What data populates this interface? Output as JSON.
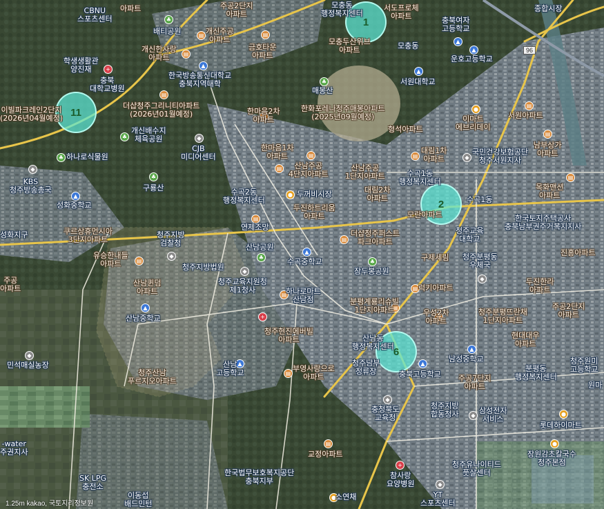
{
  "map": {
    "road_badge": "96",
    "copyright": "1.25m  kakao, 국토지리정보원"
  },
  "clusters": [
    {
      "id": "c1",
      "label": "1"
    },
    {
      "id": "c2",
      "label": "2"
    },
    {
      "id": "c6",
      "label": "6"
    },
    {
      "id": "c11",
      "label": "11"
    }
  ],
  "places": [
    {
      "text": "CBNU\n스포츠센터"
    },
    {
      "text": "아파트"
    },
    {
      "text": "배티공원"
    },
    {
      "text": "주공2단지\n아파트"
    },
    {
      "text": "개신주공\n아파트"
    },
    {
      "text": "금호타운\n아파트"
    },
    {
      "text": "모충동\n행정복지센터"
    },
    {
      "text": "서도프로체\n아파트"
    },
    {
      "text": "충북여자\n고등학교"
    },
    {
      "text": "종합시장"
    },
    {
      "text": "학생생활관\n양진재"
    },
    {
      "text": "개신한사랑\n아파트"
    },
    {
      "text": "한국방송통신대학교\n충북지역대학"
    },
    {
      "text": "모충두산위브\n아파트"
    },
    {
      "text": "모충동"
    },
    {
      "text": "운호고등학교"
    },
    {
      "text": "충북\n대학교병원"
    },
    {
      "text": "매봉산"
    },
    {
      "text": "서원대학교"
    },
    {
      "text": "더샵청주그리니티아파트\n(2026년01월예정)"
    },
    {
      "text": "한마음2차\n아파트"
    },
    {
      "text": "한화포레나청주매봉아파트\n(2025년09월예정)"
    },
    {
      "text": "이마트\n에브리데이"
    },
    {
      "text": "서원아파트"
    },
    {
      "text": "이빌파크레인2단지\n(2026년04월예정)"
    },
    {
      "text": "개신배수지\n체육공원"
    },
    {
      "text": "형석아파트"
    },
    {
      "text": "CJB\n미디어센터"
    },
    {
      "text": "한마음1차\n아파트"
    },
    {
      "text": "대림1차\n아파트"
    },
    {
      "text": "국민건강보험공단\n청주서원지사"
    },
    {
      "text": "남부상가\n아파트"
    },
    {
      "text": "하나로식물원"
    },
    {
      "text": "산남주공\n4단지아파트"
    },
    {
      "text": "산남주공\n1단지아파트"
    },
    {
      "text": "수곡1동\n행정복지센터"
    },
    {
      "text": "KBS\n청주방송총국"
    },
    {
      "text": "구룡산"
    },
    {
      "text": "수곡2동\n행정복지센터"
    },
    {
      "text": "두꺼비시장"
    },
    {
      "text": "대림2차\n아파트"
    },
    {
      "text": "목화맨션\n아파트"
    },
    {
      "text": "성화중학교"
    },
    {
      "text": "두진하트리움\n아파트"
    },
    {
      "text": "모란아파트"
    },
    {
      "text": "수곡1동"
    },
    {
      "text": "한국토지주택공사\n충북남부권주거복지지사"
    },
    {
      "text": "쿠르상휴먼시아\n3단지아파트"
    },
    {
      "text": "청주지방\n검찰청"
    },
    {
      "text": "연제조망"
    },
    {
      "text": "더샵청주퍼스트\n파크아파트"
    },
    {
      "text": "청주교육\n대학교"
    },
    {
      "text": "성화지구"
    },
    {
      "text": "산남공원"
    },
    {
      "text": "유승한내들\n아파트"
    },
    {
      "text": "청주지방법원"
    },
    {
      "text": "수곡중학교"
    },
    {
      "text": "구제세림"
    },
    {
      "text": "청주분평동\n우체국"
    },
    {
      "text": "진흥아파트"
    },
    {
      "text": "잠두봉공원"
    },
    {
      "text": "산남퀸덤\n아파트"
    },
    {
      "text": "청주교육지원청\n제1청사"
    },
    {
      "text": "두진한라\n아파트"
    },
    {
      "text": "주공\n아파트"
    },
    {
      "text": "하나로마트\n산남점"
    },
    {
      "text": "럭키아파트"
    },
    {
      "text": "분평계룡리슈빌\n1단지아파트"
    },
    {
      "text": "주공2단지\n아파트"
    },
    {
      "text": "청주분평뜨란채\n1단지아파트"
    },
    {
      "text": "산남중학교"
    },
    {
      "text": "우성2차\n아파트"
    },
    {
      "text": "청주현진에버빌\n아파트"
    },
    {
      "text": "현대대우\n아파트"
    },
    {
      "text": "산남동\n행정복지센터"
    },
    {
      "text": "남성중학교"
    },
    {
      "text": "청주원미\n고등학교"
    },
    {
      "text": "민석매실농장"
    },
    {
      "text": "청주산남\n푸르지오아파트"
    },
    {
      "text": "산남\n고등학교"
    },
    {
      "text": "부영사랑으로\n아파트"
    },
    {
      "text": "청주남부\n정류장"
    },
    {
      "text": "충북고등학교"
    },
    {
      "text": "주공7단지\n아파트"
    },
    {
      "text": "분평동\n행정복지센터"
    },
    {
      "text": "원마"
    },
    {
      "text": "충청북도\n교육청"
    },
    {
      "text": "청주지방\n합동청사"
    },
    {
      "text": "삼성전자\n서비스"
    },
    {
      "text": "롯데하이마트"
    },
    {
      "text": "-water\n주권지사"
    },
    {
      "text": "교정아파트"
    },
    {
      "text": "장원감초칼국수\n청주본점"
    },
    {
      "text": "청주유나이티드\n풋살센터"
    },
    {
      "text": "한국법무보호복지공단\n충북지부"
    },
    {
      "text": "SK LPG\n충전소"
    },
    {
      "text": "참사랑\n요양병원"
    },
    {
      "text": "이동섭\n배드민턴"
    },
    {
      "text": "소연채"
    },
    {
      "text": "YT\n스포츠센터"
    }
  ],
  "icons": [
    {
      "name": "park-icon"
    },
    {
      "name": "apartment-icon"
    },
    {
      "name": "school-icon"
    },
    {
      "name": "government-icon"
    },
    {
      "name": "hospital-icon"
    },
    {
      "name": "food-icon"
    }
  ]
}
